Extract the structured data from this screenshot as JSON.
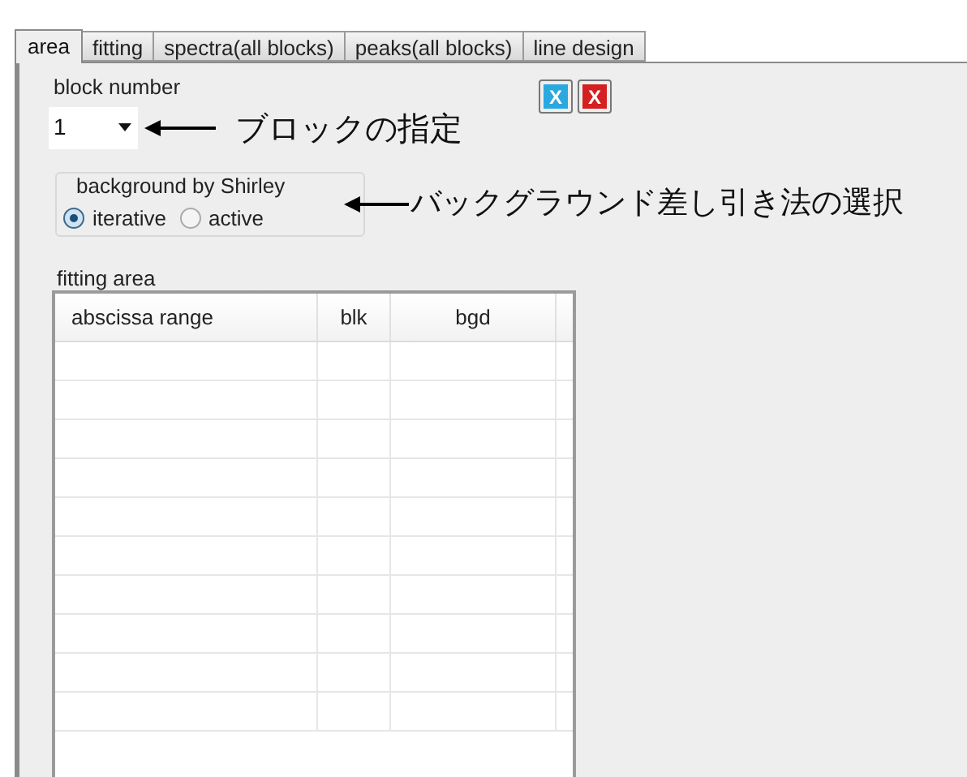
{
  "tabs": [
    {
      "label": "area",
      "selected": true
    },
    {
      "label": "fitting",
      "selected": false
    },
    {
      "label": "spectra(all blocks)",
      "selected": false
    },
    {
      "label": "peaks(all blocks)",
      "selected": false
    },
    {
      "label": "line design",
      "selected": false
    }
  ],
  "block_number": {
    "label": "block number",
    "value": "1",
    "annotation": "ブロックの指定"
  },
  "buttons": [
    {
      "label": "X",
      "color": "#2aa8e0"
    },
    {
      "label": "X",
      "color": "#d42020"
    }
  ],
  "background_group": {
    "title": "background by Shirley",
    "options": [
      {
        "label": "iterative",
        "selected": true
      },
      {
        "label": "active",
        "selected": false
      }
    ],
    "annotation": "バックグラウンド差し引き法の選択"
  },
  "fitting_area": {
    "label": "fitting area",
    "columns": [
      "abscissa range",
      "blk",
      "bgd"
    ]
  }
}
